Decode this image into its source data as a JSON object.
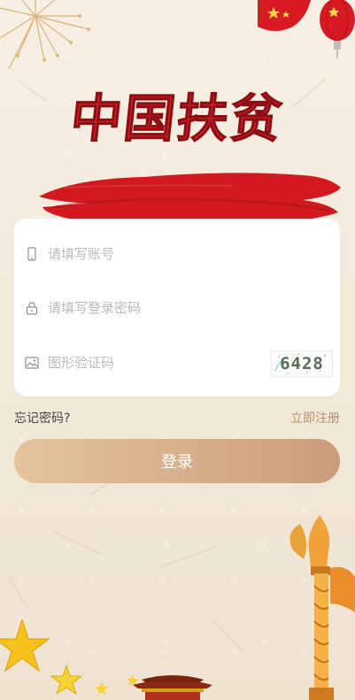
{
  "title_text": "中国扶贫",
  "form": {
    "account_placeholder": "请填写账号",
    "password_placeholder": "请填写登录密码",
    "captcha_placeholder": "图形验证码",
    "captcha_code": "6428"
  },
  "links": {
    "forgot": "忘记密码?",
    "register": "立即注册"
  },
  "buttons": {
    "login": "登录"
  },
  "colors": {
    "accent_red": "#d81b22",
    "button_start": "#e4c39d",
    "button_end": "#cb9c7c",
    "link": "#b4936c",
    "placeholder": "#b9b9b9"
  },
  "icons": [
    "phone-icon",
    "lock-icon",
    "image-icon"
  ]
}
